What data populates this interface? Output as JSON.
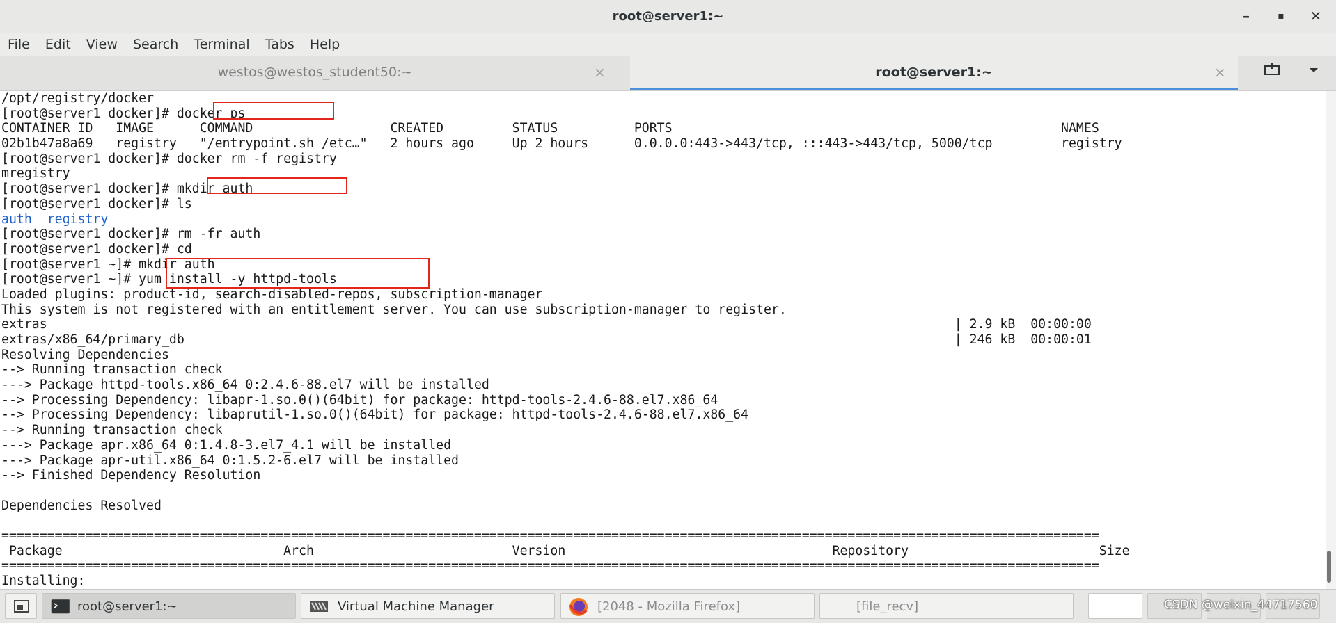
{
  "window": {
    "title": "root@server1:~",
    "controls": [
      "–",
      "▪",
      "✕"
    ]
  },
  "menu": [
    "File",
    "Edit",
    "View",
    "Search",
    "Terminal",
    "Tabs",
    "Help"
  ],
  "tabs": [
    {
      "label": "westos@westos_student50:~",
      "active": false
    },
    {
      "label": "root@server1:~",
      "active": true
    }
  ],
  "tab_close_glyph": "×",
  "terminal_lines": [
    {
      "text": "/opt/registry/docker"
    },
    {
      "text": "[root@server1 docker]# docker ps"
    },
    {
      "text": "CONTAINER ID   IMAGE      COMMAND                  CREATED         STATUS          PORTS                                                   NAMES"
    },
    {
      "text": "02b1b47a8a69   registry   \"/entrypoint.sh /etc…\"   2 hours ago     Up 2 hours      0.0.0.0:443->443/tcp, :::443->443/tcp, 5000/tcp         registry"
    },
    {
      "text": "[root@server1 docker]# docker rm -f registry"
    },
    {
      "text": "mregistry"
    },
    {
      "text": "[root@server1 docker]# mkdir auth"
    },
    {
      "text": "[root@server1 docker]# ls"
    },
    {
      "text": "auth  registry",
      "color": "blue"
    },
    {
      "text": "[root@server1 docker]# rm -fr auth"
    },
    {
      "text": "[root@server1 docker]# cd"
    },
    {
      "text": "[root@server1 ~]# mkdir auth"
    },
    {
      "text": "[root@server1 ~]# yum install -y httpd-tools"
    },
    {
      "text": "Loaded plugins: product-id, search-disabled-repos, subscription-manager"
    },
    {
      "text": "This system is not registered with an entitlement server. You can use subscription-manager to register."
    },
    {
      "text": "extras                                                                                                                       | 2.9 kB  00:00:00"
    },
    {
      "text": "extras/x86_64/primary_db                                                                                                     | 246 kB  00:00:01"
    },
    {
      "text": "Resolving Dependencies"
    },
    {
      "text": "--> Running transaction check"
    },
    {
      "text": "---> Package httpd-tools.x86_64 0:2.4.6-88.el7 will be installed"
    },
    {
      "text": "--> Processing Dependency: libapr-1.so.0()(64bit) for package: httpd-tools-2.4.6-88.el7.x86_64"
    },
    {
      "text": "--> Processing Dependency: libaprutil-1.so.0()(64bit) for package: httpd-tools-2.4.6-88.el7.x86_64"
    },
    {
      "text": "--> Running transaction check"
    },
    {
      "text": "---> Package apr.x86_64 0:1.4.8-3.el7_4.1 will be installed"
    },
    {
      "text": "---> Package apr-util.x86_64 0:1.5.2-6.el7 will be installed"
    },
    {
      "text": "--> Finished Dependency Resolution"
    },
    {
      "text": ""
    },
    {
      "text": "Dependencies Resolved"
    },
    {
      "text": ""
    },
    {
      "text": "================================================================================================================================================"
    },
    {
      "text": " Package                             Arch                          Version                                   Repository                         Size"
    },
    {
      "text": "================================================================================================================================================"
    },
    {
      "text": "Installing:"
    }
  ],
  "highlight_color": "#e3261c",
  "taskbar": {
    "items": [
      {
        "label": "root@server1:~",
        "icon": "terminal-icon",
        "active": true
      },
      {
        "label": "Virtual Machine Manager",
        "icon": "virt-manager-icon",
        "active": false
      },
      {
        "label": "[2048 - Mozilla Firefox]",
        "icon": "firefox-icon",
        "active": false
      },
      {
        "label": "[file_recv]",
        "icon": "",
        "active": false
      }
    ]
  },
  "watermark": "CSDN @weixin_44717560"
}
